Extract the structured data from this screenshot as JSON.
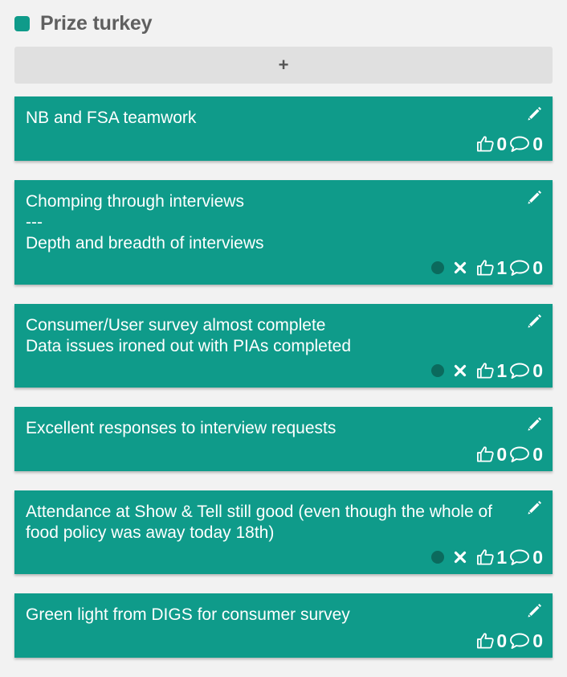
{
  "column": {
    "title": "Prize turkey",
    "accent_color": "#0f9b8a",
    "add_label": "+"
  },
  "cards": [
    {
      "text": "NB and FSA teamwork",
      "likes": "0",
      "comments": "0",
      "has_unvote": false
    },
    {
      "text": "Chomping through interviews\n---\nDepth and breadth of interviews",
      "likes": "1",
      "comments": "0",
      "has_unvote": true
    },
    {
      "text": "Consumer/User survey almost complete\nData issues ironed out with PIAs completed",
      "likes": "1",
      "comments": "0",
      "has_unvote": true
    },
    {
      "text": "Excellent responses to interview requests",
      "likes": "0",
      "comments": "0",
      "has_unvote": false
    },
    {
      "text": "Attendance at Show & Tell still good (even though the whole of food policy was away today 18th)",
      "likes": "1",
      "comments": "0",
      "has_unvote": true
    },
    {
      "text": "Green light from DIGS for consumer survey",
      "likes": "0",
      "comments": "0",
      "has_unvote": false
    }
  ],
  "icons": {
    "edit": "pencil-icon",
    "like": "thumbs-up-icon",
    "comment": "comment-bubble-icon",
    "unvote": "close-icon",
    "voted_marker": "vote-dot"
  }
}
